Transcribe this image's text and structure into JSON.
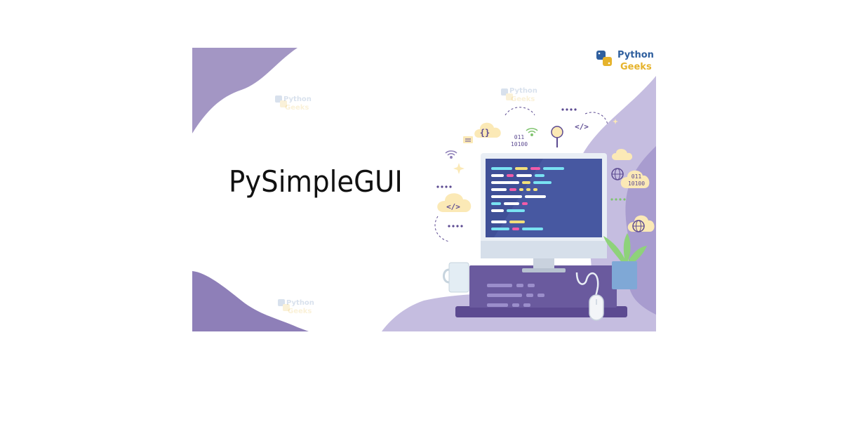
{
  "banner": {
    "title": "PySimpleGUI",
    "brand": {
      "line1": "Python",
      "line2": "Geeks"
    },
    "watermark": {
      "line1": "Python",
      "line2": "Geeks"
    },
    "icons": {
      "braces": "{}",
      "code": "</>",
      "binary1": "011",
      "binary2": "10100",
      "right_binary1": "011",
      "right_binary2": "10100"
    },
    "colors": {
      "purple_dark": "#5c4a91",
      "purple_mid": "#8e7fb8",
      "purple_light": "#b8addb",
      "monitor_screen": "#3f4f97",
      "brand_blue": "#2f5f9e",
      "brand_yellow": "#e6b32c"
    }
  }
}
